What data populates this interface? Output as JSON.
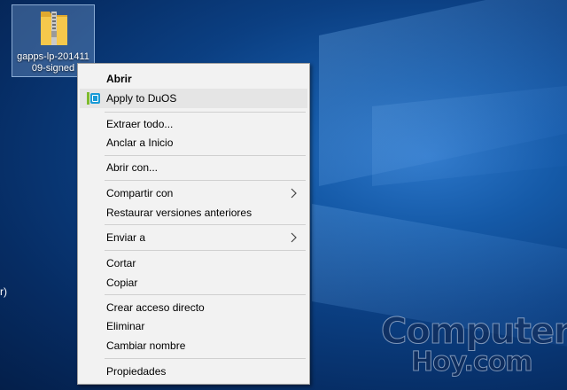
{
  "desktop": {
    "file_icon": {
      "name": "zip-folder-icon",
      "label_line1": "gapps-lp-201411",
      "label_line2": "09-signed"
    },
    "partial_left_text": "r)"
  },
  "context_menu": {
    "items": [
      {
        "label": "Abrir",
        "bold": true
      },
      {
        "label": "Apply to DuOS",
        "icon": "duos-icon",
        "highlighted": true
      },
      {
        "label": "Extraer todo..."
      },
      {
        "label": "Anclar a Inicio"
      },
      {
        "label": "Abrir con..."
      },
      {
        "label": "Compartir con",
        "submenu": true
      },
      {
        "label": "Restaurar versiones anteriores"
      },
      {
        "label": "Enviar a",
        "submenu": true
      },
      {
        "label": "Cortar"
      },
      {
        "label": "Copiar"
      },
      {
        "label": "Crear acceso directo"
      },
      {
        "label": "Eliminar"
      },
      {
        "label": "Cambiar nombre"
      },
      {
        "label": "Propiedades"
      }
    ]
  },
  "watermark": {
    "line1": "Computer",
    "line2": "Hoy.com"
  },
  "colors": {
    "desktop_background": "#0b3f82",
    "menu_background": "#f2f2f2",
    "menu_hover": "#e5e5e5",
    "duos_icon_green": "#7dbb2e",
    "duos_icon_blue": "#1a9bd7",
    "folder_yellow": "#f5c84c"
  }
}
